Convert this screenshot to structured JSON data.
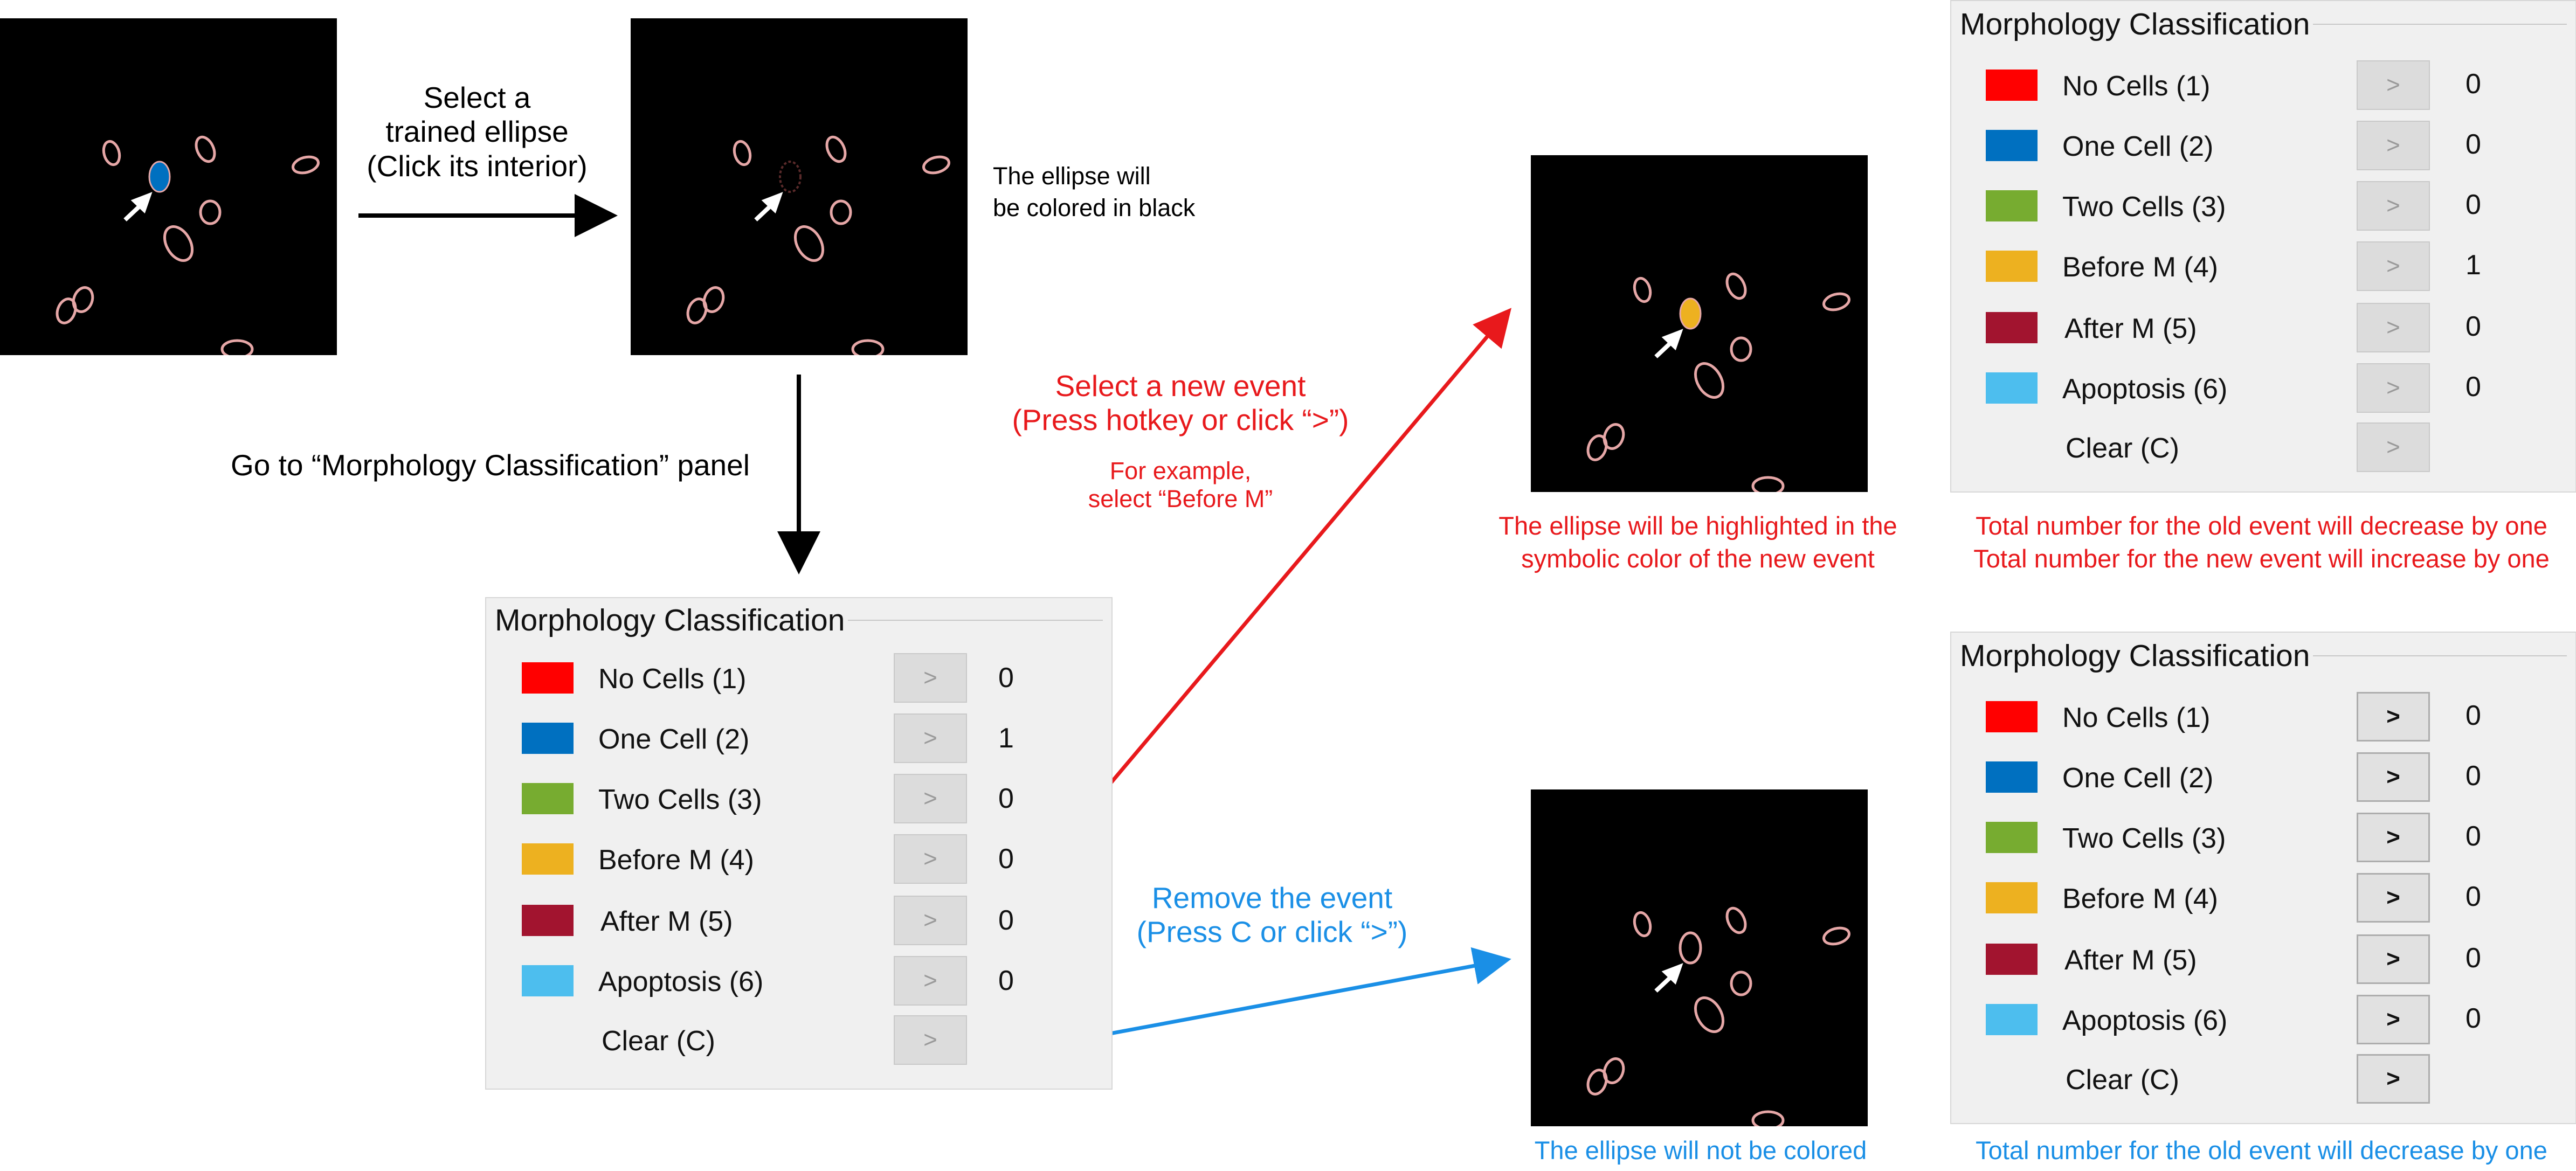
{
  "colors": {
    "no_cells": "#ff0000",
    "one_cell": "#0070c0",
    "two_cells": "#77ac30",
    "before_m": "#edb120",
    "after_m": "#a2142f",
    "apoptosis": "#4dbeee",
    "annotation_red": "#e8191c",
    "annotation_blue": "#1a8fe6"
  },
  "step1": {
    "line1": "Select a",
    "line2": "trained ellipse",
    "line3": "(Click its interior)"
  },
  "step1_result": {
    "line1": "The ellipse will",
    "line2": "be colored in black"
  },
  "step2": {
    "text": "Go to “Morphology Classification” panel"
  },
  "select_event": {
    "line1": "Select a new event",
    "line2": "(Press hotkey or click “>”)",
    "example1": "For example,",
    "example2": "select “Before M”"
  },
  "remove_event": {
    "line1": "Remove the event",
    "line2": "(Press C or click “>”)"
  },
  "highlight_caption": {
    "line1": "The ellipse will be highlighted in the",
    "line2": "symbolic color of the new event"
  },
  "not_colored_caption": {
    "text": "The ellipse will not be colored"
  },
  "panel_select_caption": {
    "line1": "Total number for the old event will decrease by one",
    "line2": "Total number for the new event will increase by one"
  },
  "panel_clear_caption": {
    "text": "Total number for the old event will decrease by one"
  },
  "panels": {
    "main": {
      "title": "Morphology Classification",
      "rows": [
        {
          "label": "No Cells (1)",
          "button": ">",
          "count": "0"
        },
        {
          "label": "One Cell (2)",
          "button": ">",
          "count": "1"
        },
        {
          "label": "Two Cells (3)",
          "button": ">",
          "count": "0"
        },
        {
          "label": "Before M (4)",
          "button": ">",
          "count": "0"
        },
        {
          "label": "After M (5)",
          "button": ">",
          "count": "0"
        },
        {
          "label": "Apoptosis (6)",
          "button": ">",
          "count": "0"
        }
      ],
      "clear": {
        "label": "Clear (C)",
        "button": ">"
      }
    },
    "after_select": {
      "title": "Morphology Classification",
      "rows": [
        {
          "label": "No Cells (1)",
          "button": ">",
          "count": "0"
        },
        {
          "label": "One Cell (2)",
          "button": ">",
          "count": "0"
        },
        {
          "label": "Two Cells (3)",
          "button": ">",
          "count": "0"
        },
        {
          "label": "Before M (4)",
          "button": ">",
          "count": "1"
        },
        {
          "label": "After M (5)",
          "button": ">",
          "count": "0"
        },
        {
          "label": "Apoptosis (6)",
          "button": ">",
          "count": "0"
        }
      ],
      "clear": {
        "label": "Clear (C)",
        "button": ">"
      }
    },
    "after_clear": {
      "title": "Morphology Classification",
      "rows": [
        {
          "label": "No Cells (1)",
          "button": ">",
          "count": "0"
        },
        {
          "label": "One Cell (2)",
          "button": ">",
          "count": "0"
        },
        {
          "label": "Two Cells (3)",
          "button": ">",
          "count": "0"
        },
        {
          "label": "Before M (4)",
          "button": ">",
          "count": "0"
        },
        {
          "label": "After M (5)",
          "button": ">",
          "count": "0"
        },
        {
          "label": "Apoptosis (6)",
          "button": ">",
          "count": "0"
        }
      ],
      "clear": {
        "label": "Clear (C)",
        "button": ">"
      }
    }
  }
}
